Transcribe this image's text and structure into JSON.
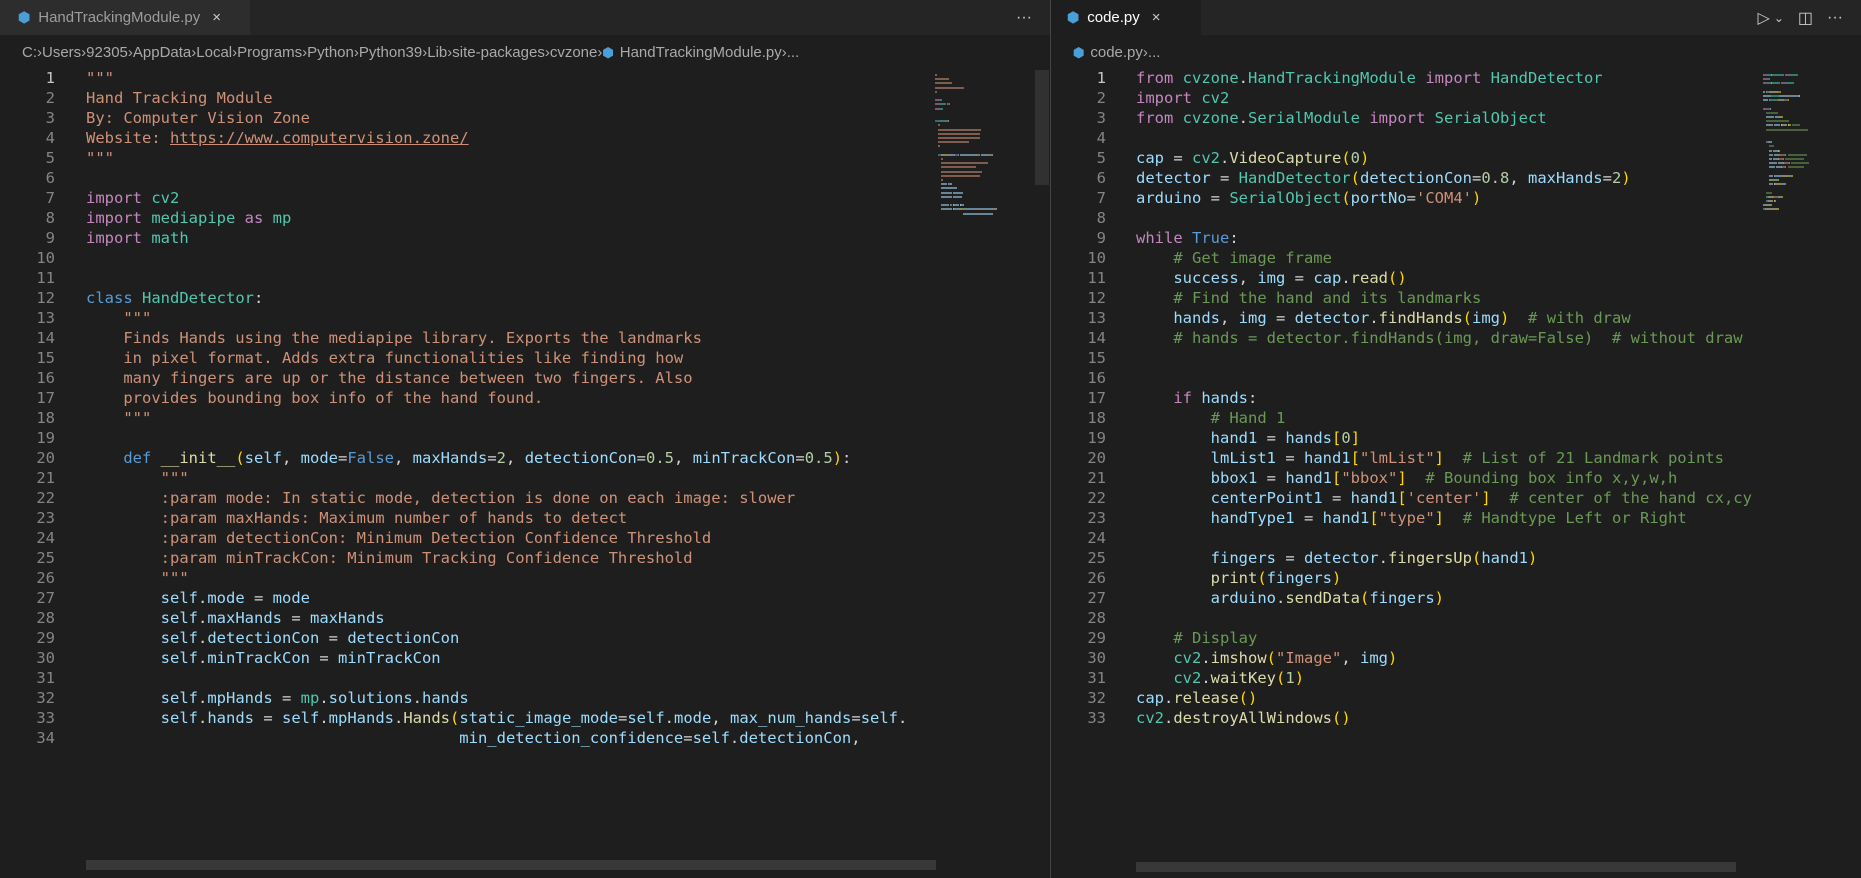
{
  "left": {
    "tab": {
      "label": "HandTrackingModule.py",
      "close": "×",
      "more": "···"
    },
    "breadcrumb": [
      "C:",
      "Users",
      "92305",
      "AppData",
      "Local",
      "Programs",
      "Python",
      "Python39",
      "Lib",
      "site-packages",
      "cvzone",
      "HandTrackingModule.py",
      "..."
    ],
    "current_line": 1,
    "lines": [
      [
        [
          "str",
          "\"\"\""
        ]
      ],
      [
        [
          "str",
          "Hand Tracking Module"
        ]
      ],
      [
        [
          "str",
          "By: Computer Vision Zone"
        ]
      ],
      [
        [
          "str",
          "Website: "
        ],
        [
          "url",
          "https://www.computervision.zone/"
        ]
      ],
      [
        [
          "str",
          "\"\"\""
        ]
      ],
      [],
      [
        [
          "kw",
          "import "
        ],
        [
          "cls",
          "cv2"
        ]
      ],
      [
        [
          "kw",
          "import "
        ],
        [
          "cls",
          "mediapipe"
        ],
        [
          "kw",
          " as "
        ],
        [
          "cls",
          "mp"
        ]
      ],
      [
        [
          "kw",
          "import "
        ],
        [
          "cls",
          "math"
        ]
      ],
      [],
      [],
      [
        [
          "kb",
          "class "
        ],
        [
          "cls",
          "HandDetector"
        ],
        [
          "txt",
          ":"
        ]
      ],
      [
        [
          "txt",
          "    "
        ],
        [
          "str",
          "\"\"\""
        ]
      ],
      [
        [
          "txt",
          "    "
        ],
        [
          "str",
          "Finds Hands using the mediapipe library. Exports the landmarks"
        ]
      ],
      [
        [
          "txt",
          "    "
        ],
        [
          "str",
          "in pixel format. Adds extra functionalities like finding how"
        ]
      ],
      [
        [
          "txt",
          "    "
        ],
        [
          "str",
          "many fingers are up or the distance between two fingers. Also"
        ]
      ],
      [
        [
          "txt",
          "    "
        ],
        [
          "str",
          "provides bounding box info of the hand found."
        ]
      ],
      [
        [
          "txt",
          "    "
        ],
        [
          "str",
          "\"\"\""
        ]
      ],
      [],
      [
        [
          "txt",
          "    "
        ],
        [
          "kb",
          "def "
        ],
        [
          "fn",
          "__init__"
        ],
        [
          "br",
          "("
        ],
        [
          "var",
          "self"
        ],
        [
          "txt",
          ", "
        ],
        [
          "var",
          "mode"
        ],
        [
          "txt",
          "="
        ],
        [
          "kb",
          "False"
        ],
        [
          "txt",
          ", "
        ],
        [
          "var",
          "maxHands"
        ],
        [
          "txt",
          "="
        ],
        [
          "num",
          "2"
        ],
        [
          "txt",
          ", "
        ],
        [
          "var",
          "detectionCon"
        ],
        [
          "txt",
          "="
        ],
        [
          "num",
          "0.5"
        ],
        [
          "txt",
          ", "
        ],
        [
          "var",
          "minTrackCon"
        ],
        [
          "txt",
          "="
        ],
        [
          "num",
          "0.5"
        ],
        [
          "br",
          ")"
        ],
        [
          "txt",
          ":"
        ]
      ],
      [
        [
          "txt",
          "        "
        ],
        [
          "str",
          "\"\"\""
        ]
      ],
      [
        [
          "txt",
          "        "
        ],
        [
          "str",
          ":param mode: In static mode, detection is done on each image: slower"
        ]
      ],
      [
        [
          "txt",
          "        "
        ],
        [
          "str",
          ":param maxHands: Maximum number of hands to detect"
        ]
      ],
      [
        [
          "txt",
          "        "
        ],
        [
          "str",
          ":param detectionCon: Minimum Detection Confidence Threshold"
        ]
      ],
      [
        [
          "txt",
          "        "
        ],
        [
          "str",
          ":param minTrackCon: Minimum Tracking Confidence Threshold"
        ]
      ],
      [
        [
          "txt",
          "        "
        ],
        [
          "str",
          "\"\"\""
        ]
      ],
      [
        [
          "txt",
          "        "
        ],
        [
          "var",
          "self"
        ],
        [
          "txt",
          "."
        ],
        [
          "var",
          "mode"
        ],
        [
          "txt",
          " = "
        ],
        [
          "var",
          "mode"
        ]
      ],
      [
        [
          "txt",
          "        "
        ],
        [
          "var",
          "self"
        ],
        [
          "txt",
          "."
        ],
        [
          "var",
          "maxHands"
        ],
        [
          "txt",
          " = "
        ],
        [
          "var",
          "maxHands"
        ]
      ],
      [
        [
          "txt",
          "        "
        ],
        [
          "var",
          "self"
        ],
        [
          "txt",
          "."
        ],
        [
          "var",
          "detectionCon"
        ],
        [
          "txt",
          " = "
        ],
        [
          "var",
          "detectionCon"
        ]
      ],
      [
        [
          "txt",
          "        "
        ],
        [
          "var",
          "self"
        ],
        [
          "txt",
          "."
        ],
        [
          "var",
          "minTrackCon"
        ],
        [
          "txt",
          " = "
        ],
        [
          "var",
          "minTrackCon"
        ]
      ],
      [],
      [
        [
          "txt",
          "        "
        ],
        [
          "var",
          "self"
        ],
        [
          "txt",
          "."
        ],
        [
          "var",
          "mpHands"
        ],
        [
          "txt",
          " = "
        ],
        [
          "cls",
          "mp"
        ],
        [
          "txt",
          "."
        ],
        [
          "var",
          "solutions"
        ],
        [
          "txt",
          "."
        ],
        [
          "var",
          "hands"
        ]
      ],
      [
        [
          "txt",
          "        "
        ],
        [
          "var",
          "self"
        ],
        [
          "txt",
          "."
        ],
        [
          "var",
          "hands"
        ],
        [
          "txt",
          " = "
        ],
        [
          "var",
          "self"
        ],
        [
          "txt",
          "."
        ],
        [
          "var",
          "mpHands"
        ],
        [
          "txt",
          "."
        ],
        [
          "fn",
          "Hands"
        ],
        [
          "br",
          "("
        ],
        [
          "var",
          "static_image_mode"
        ],
        [
          "txt",
          "="
        ],
        [
          "var",
          "self"
        ],
        [
          "txt",
          "."
        ],
        [
          "var",
          "mode"
        ],
        [
          "txt",
          ", "
        ],
        [
          "var",
          "max_num_hands"
        ],
        [
          "txt",
          "="
        ],
        [
          "var",
          "self"
        ],
        [
          "txt",
          "."
        ]
      ],
      [
        [
          "txt",
          "                                        "
        ],
        [
          "var",
          "min_detection_confidence"
        ],
        [
          "txt",
          "="
        ],
        [
          "var",
          "self"
        ],
        [
          "txt",
          "."
        ],
        [
          "var",
          "detectionCon"
        ],
        [
          "txt",
          ","
        ]
      ]
    ]
  },
  "right": {
    "tab": {
      "label": "code.py",
      "close": "×"
    },
    "actions": {
      "run": "▷",
      "run_menu": "⌄",
      "split": "◫",
      "more": "···"
    },
    "breadcrumb": [
      "code.py",
      "..."
    ],
    "current_line": 1,
    "lines": [
      [
        [
          "kw",
          "from "
        ],
        [
          "cls",
          "cvzone"
        ],
        [
          "txt",
          "."
        ],
        [
          "cls",
          "HandTrackingModule"
        ],
        [
          "kw",
          " import "
        ],
        [
          "cls",
          "HandDetector"
        ]
      ],
      [
        [
          "kw",
          "import "
        ],
        [
          "cls",
          "cv2"
        ]
      ],
      [
        [
          "kw",
          "from "
        ],
        [
          "cls",
          "cvzone"
        ],
        [
          "txt",
          "."
        ],
        [
          "cls",
          "SerialModule"
        ],
        [
          "kw",
          " import "
        ],
        [
          "cls",
          "SerialObject"
        ]
      ],
      [],
      [
        [
          "var",
          "cap"
        ],
        [
          "txt",
          " = "
        ],
        [
          "cls",
          "cv2"
        ],
        [
          "txt",
          "."
        ],
        [
          "fn",
          "VideoCapture"
        ],
        [
          "br",
          "("
        ],
        [
          "num",
          "0"
        ],
        [
          "br",
          ")"
        ]
      ],
      [
        [
          "var",
          "detector"
        ],
        [
          "txt",
          " = "
        ],
        [
          "cls",
          "HandDetector"
        ],
        [
          "br",
          "("
        ],
        [
          "var",
          "detectionCon"
        ],
        [
          "txt",
          "="
        ],
        [
          "num",
          "0.8"
        ],
        [
          "txt",
          ", "
        ],
        [
          "var",
          "maxHands"
        ],
        [
          "txt",
          "="
        ],
        [
          "num",
          "2"
        ],
        [
          "br",
          ")"
        ]
      ],
      [
        [
          "var",
          "arduino"
        ],
        [
          "txt",
          " = "
        ],
        [
          "cls",
          "SerialObject"
        ],
        [
          "br",
          "("
        ],
        [
          "var",
          "portNo"
        ],
        [
          "txt",
          "="
        ],
        [
          "str",
          "'COM4'"
        ],
        [
          "br",
          ")"
        ]
      ],
      [],
      [
        [
          "kw",
          "while "
        ],
        [
          "kb",
          "True"
        ],
        [
          "txt",
          ":"
        ]
      ],
      [
        [
          "txt",
          "    "
        ],
        [
          "com",
          "# Get image frame"
        ]
      ],
      [
        [
          "txt",
          "    "
        ],
        [
          "var",
          "success"
        ],
        [
          "txt",
          ", "
        ],
        [
          "var",
          "img"
        ],
        [
          "txt",
          " = "
        ],
        [
          "var",
          "cap"
        ],
        [
          "txt",
          "."
        ],
        [
          "fn",
          "read"
        ],
        [
          "br",
          "()"
        ]
      ],
      [
        [
          "txt",
          "    "
        ],
        [
          "com",
          "# Find the hand and its landmarks"
        ]
      ],
      [
        [
          "txt",
          "    "
        ],
        [
          "var",
          "hands"
        ],
        [
          "txt",
          ", "
        ],
        [
          "var",
          "img"
        ],
        [
          "txt",
          " = "
        ],
        [
          "var",
          "detector"
        ],
        [
          "txt",
          "."
        ],
        [
          "fn",
          "findHands"
        ],
        [
          "br",
          "("
        ],
        [
          "var",
          "img"
        ],
        [
          "br",
          ")"
        ],
        [
          "txt",
          "  "
        ],
        [
          "com",
          "# with draw"
        ]
      ],
      [
        [
          "txt",
          "    "
        ],
        [
          "com",
          "# hands = detector.findHands(img, draw=False)  # without draw"
        ]
      ],
      [],
      [],
      [
        [
          "txt",
          "    "
        ],
        [
          "kw",
          "if "
        ],
        [
          "var",
          "hands"
        ],
        [
          "txt",
          ":"
        ]
      ],
      [
        [
          "txt",
          "        "
        ],
        [
          "com",
          "# Hand 1"
        ]
      ],
      [
        [
          "txt",
          "        "
        ],
        [
          "var",
          "hand1"
        ],
        [
          "txt",
          " = "
        ],
        [
          "var",
          "hands"
        ],
        [
          "br",
          "["
        ],
        [
          "num",
          "0"
        ],
        [
          "br",
          "]"
        ]
      ],
      [
        [
          "txt",
          "        "
        ],
        [
          "var",
          "lmList1"
        ],
        [
          "txt",
          " = "
        ],
        [
          "var",
          "hand1"
        ],
        [
          "br",
          "["
        ],
        [
          "str",
          "\"lmList\""
        ],
        [
          "br",
          "]"
        ],
        [
          "txt",
          "  "
        ],
        [
          "com",
          "# List of 21 Landmark points"
        ]
      ],
      [
        [
          "txt",
          "        "
        ],
        [
          "var",
          "bbox1"
        ],
        [
          "txt",
          " = "
        ],
        [
          "var",
          "hand1"
        ],
        [
          "br",
          "["
        ],
        [
          "str",
          "\"bbox\""
        ],
        [
          "br",
          "]"
        ],
        [
          "txt",
          "  "
        ],
        [
          "com",
          "# Bounding box info x,y,w,h"
        ]
      ],
      [
        [
          "txt",
          "        "
        ],
        [
          "var",
          "centerPoint1"
        ],
        [
          "txt",
          " = "
        ],
        [
          "var",
          "hand1"
        ],
        [
          "br",
          "["
        ],
        [
          "str",
          "'center'"
        ],
        [
          "br",
          "]"
        ],
        [
          "txt",
          "  "
        ],
        [
          "com",
          "# center of the hand cx,cy"
        ]
      ],
      [
        [
          "txt",
          "        "
        ],
        [
          "var",
          "handType1"
        ],
        [
          "txt",
          " = "
        ],
        [
          "var",
          "hand1"
        ],
        [
          "br",
          "["
        ],
        [
          "str",
          "\"type\""
        ],
        [
          "br",
          "]"
        ],
        [
          "txt",
          "  "
        ],
        [
          "com",
          "# Handtype Left or Right"
        ]
      ],
      [],
      [
        [
          "txt",
          "        "
        ],
        [
          "var",
          "fingers"
        ],
        [
          "txt",
          " = "
        ],
        [
          "var",
          "detector"
        ],
        [
          "txt",
          "."
        ],
        [
          "fn",
          "fingersUp"
        ],
        [
          "br",
          "("
        ],
        [
          "var",
          "hand1"
        ],
        [
          "br",
          ")"
        ]
      ],
      [
        [
          "txt",
          "        "
        ],
        [
          "fn",
          "print"
        ],
        [
          "br",
          "("
        ],
        [
          "var",
          "fingers"
        ],
        [
          "br",
          ")"
        ]
      ],
      [
        [
          "txt",
          "        "
        ],
        [
          "var",
          "arduino"
        ],
        [
          "txt",
          "."
        ],
        [
          "fn",
          "sendData"
        ],
        [
          "br",
          "("
        ],
        [
          "var",
          "fingers"
        ],
        [
          "br",
          ")"
        ]
      ],
      [],
      [
        [
          "txt",
          "    "
        ],
        [
          "com",
          "# Display"
        ]
      ],
      [
        [
          "txt",
          "    "
        ],
        [
          "cls",
          "cv2"
        ],
        [
          "txt",
          "."
        ],
        [
          "fn",
          "imshow"
        ],
        [
          "br",
          "("
        ],
        [
          "str",
          "\"Image\""
        ],
        [
          "txt",
          ", "
        ],
        [
          "var",
          "img"
        ],
        [
          "br",
          ")"
        ]
      ],
      [
        [
          "txt",
          "    "
        ],
        [
          "cls",
          "cv2"
        ],
        [
          "txt",
          "."
        ],
        [
          "fn",
          "waitKey"
        ],
        [
          "br",
          "("
        ],
        [
          "num",
          "1"
        ],
        [
          "br",
          ")"
        ]
      ],
      [
        [
          "var",
          "cap"
        ],
        [
          "txt",
          "."
        ],
        [
          "fn",
          "release"
        ],
        [
          "br",
          "()"
        ]
      ],
      [
        [
          "cls",
          "cv2"
        ],
        [
          "txt",
          "."
        ],
        [
          "fn",
          "destroyAllWindows"
        ],
        [
          "br",
          "()"
        ]
      ]
    ]
  }
}
